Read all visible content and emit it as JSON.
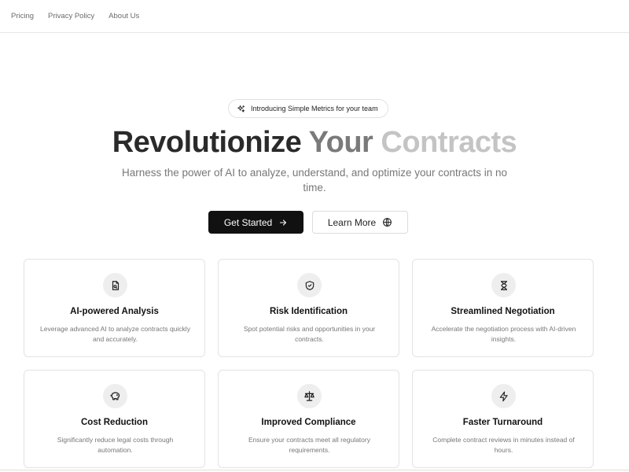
{
  "nav": {
    "links": [
      "Pricing",
      "Privacy Policy",
      "About Us"
    ]
  },
  "hero": {
    "badge": "Introducing Simple Metrics for your team",
    "title_words": [
      "Revolutionize",
      "Your",
      "Contracts"
    ],
    "subtitle": "Harness the power of AI to analyze, understand, and optimize your contracts in no time.",
    "primary_cta": "Get Started",
    "secondary_cta": "Learn More"
  },
  "features": [
    {
      "title": "AI-powered Analysis",
      "description": "Leverage advanced AI to analyze contracts quickly and accurately.",
      "icon": "document-search-icon"
    },
    {
      "title": "Risk Identification",
      "description": "Spot potential risks and opportunities in your contracts.",
      "icon": "shield-check-icon"
    },
    {
      "title": "Streamlined Negotiation",
      "description": "Accelerate the negotiation process with AI-driven insights.",
      "icon": "hourglass-icon"
    },
    {
      "title": "Cost Reduction",
      "description": "Significantly reduce legal costs through automation.",
      "icon": "piggy-bank-icon"
    },
    {
      "title": "Improved Compliance",
      "description": "Ensure your contracts meet all regulatory requirements.",
      "icon": "scale-icon"
    },
    {
      "title": "Faster Turnaround",
      "description": "Complete contract reviews in minutes instead of hours.",
      "icon": "lightning-icon"
    }
  ]
}
